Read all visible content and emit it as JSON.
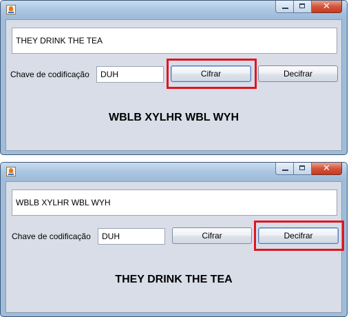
{
  "windows": [
    {
      "message_value": "THEY DRINK THE TEA",
      "key_label": "Chave de codificação",
      "key_value": "DUH",
      "encrypt_label": "Cifrar",
      "decrypt_label": "Decifrar",
      "result": "WBLB XYLHR WBL WYH",
      "highlighted_button": "encrypt"
    },
    {
      "message_value": "WBLB XYLHR WBL WYH",
      "key_label": "Chave de codificação",
      "key_value": "DUH",
      "encrypt_label": "Cifrar",
      "decrypt_label": "Decifrar",
      "result": "THEY DRINK THE TEA",
      "highlighted_button": "decrypt"
    }
  ],
  "colors": {
    "highlight": "#e1141e",
    "content_bg": "#d9dde8",
    "frame": "#9fbcd9"
  },
  "icons": {
    "app": "java-coffee-icon",
    "minimize": "minimize-icon",
    "maximize": "maximize-icon",
    "close": "close-icon"
  }
}
